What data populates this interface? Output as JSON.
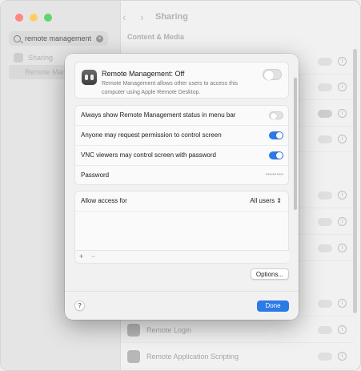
{
  "sidebar": {
    "search": {
      "value": "remote management"
    },
    "items": [
      {
        "label": "Sharing"
      },
      {
        "label": "Remote Manag"
      }
    ]
  },
  "toolbar": {
    "title": "Sharing",
    "back": "‹",
    "forward": "›"
  },
  "background": {
    "section_title": "Content & Media",
    "rows": [
      {
        "label": "Remote Login"
      },
      {
        "label": "Remote Application Scripting"
      }
    ]
  },
  "sheet": {
    "header": {
      "title": "Remote Management: Off",
      "description": "Remote Management allows other users to access this computer using Apple Remote Desktop.",
      "enabled": false
    },
    "options": [
      {
        "label": "Always show Remote Management status in menu bar",
        "enabled": false
      },
      {
        "label": "Anyone may request permission to control screen",
        "enabled": true
      },
      {
        "label": "VNC viewers may control screen with password",
        "enabled": true
      }
    ],
    "password": {
      "label": "Password",
      "value": "••••••••"
    },
    "access": {
      "label": "Allow access for",
      "value": "All users ⇕",
      "add": "+",
      "remove": "−"
    },
    "options_button": "Options...",
    "done_button": "Done",
    "help_button": "?"
  },
  "colors": {
    "accent": "#2c7ae8"
  }
}
